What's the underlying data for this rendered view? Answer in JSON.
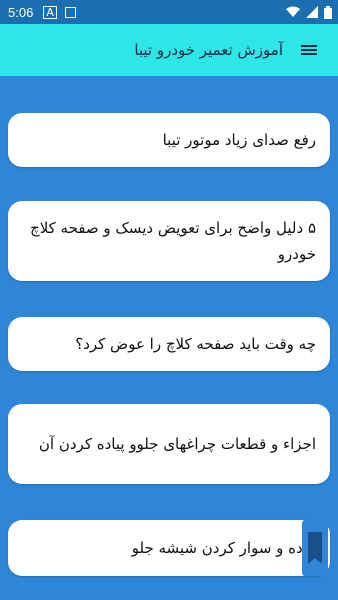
{
  "status": {
    "time": "5:06",
    "a_icon": "A"
  },
  "appbar": {
    "title": "آموزش تعمیر خودرو تیبا"
  },
  "items": [
    {
      "label": "رفع صدای زیاد موتور تیبا"
    },
    {
      "label": "۵ دلیل واضح برای تعویض دیسک و صفحه کلاچ خودرو"
    },
    {
      "label": "چه وقت باید صفحه کلاچ را عوض کرد؟"
    },
    {
      "label": "اجزاء و قطعات چراغهای جلوو پیاده کردن آن"
    },
    {
      "label": "پیاده و سوار کردن شیشه جلو"
    }
  ]
}
